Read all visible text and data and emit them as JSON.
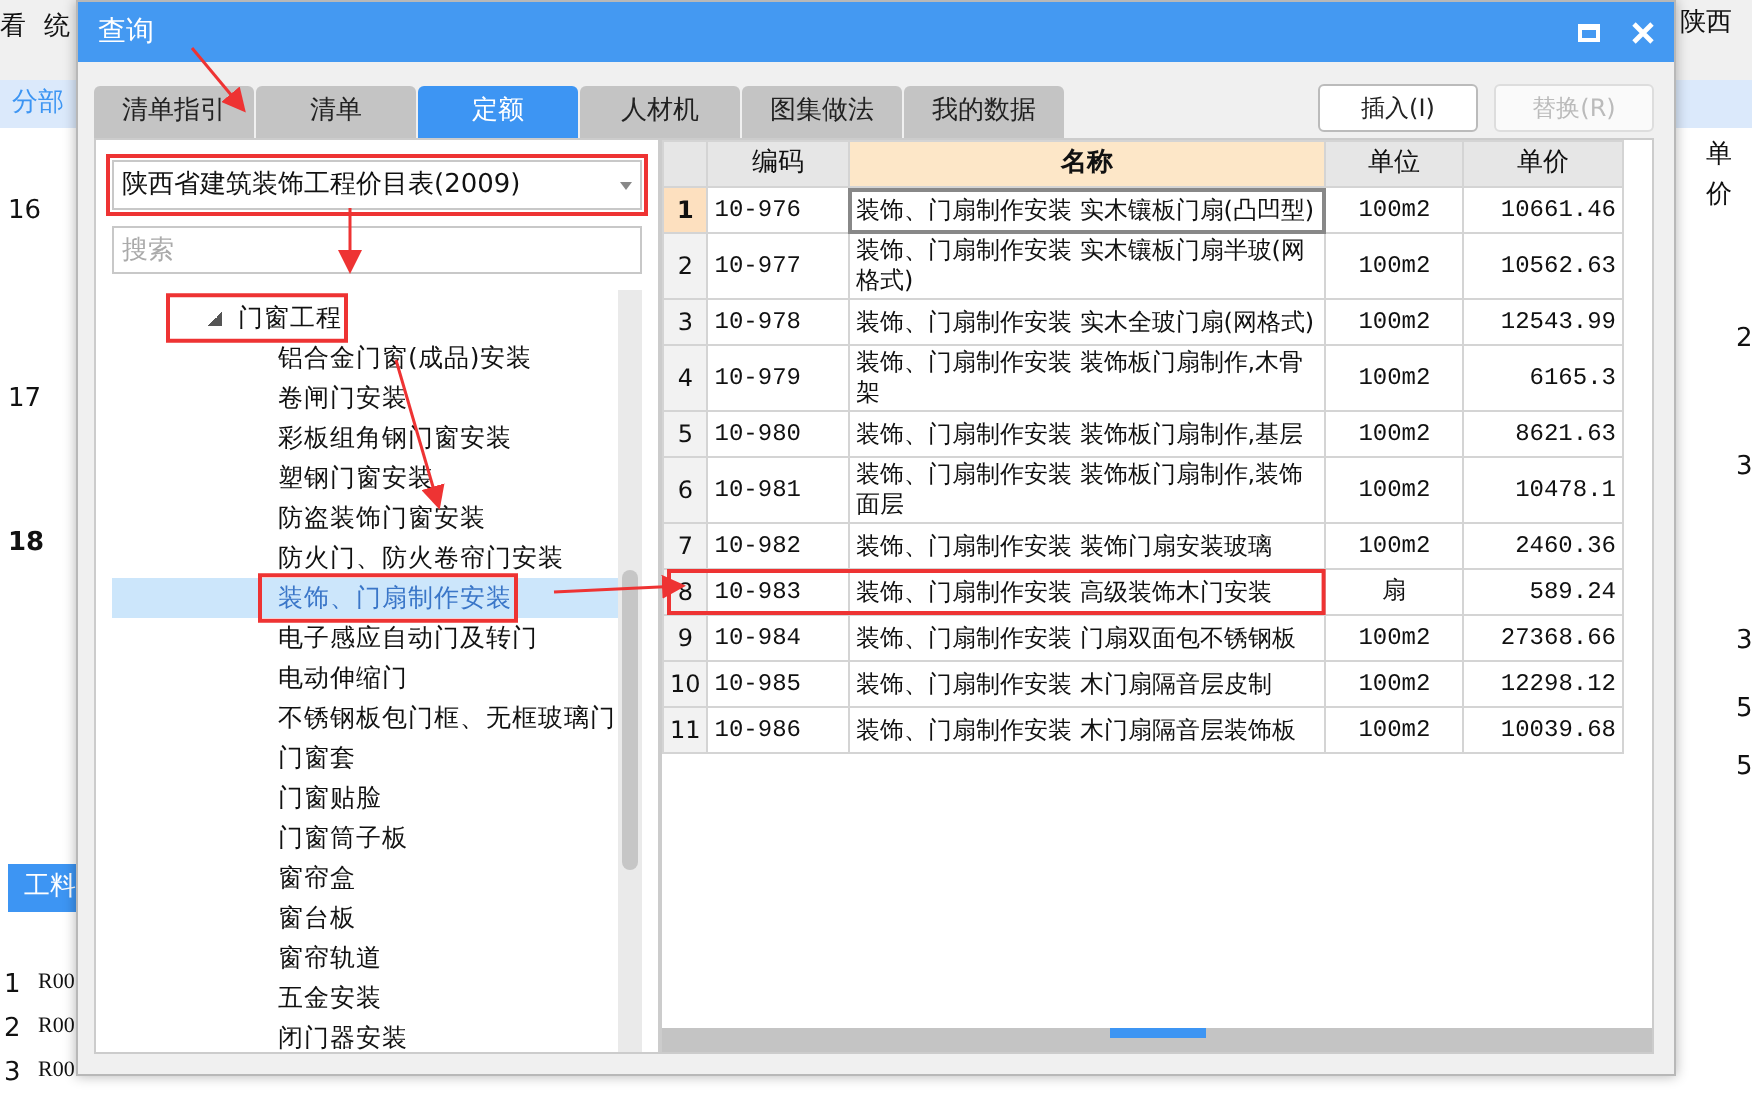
{
  "background_app": {
    "menu_texts": [
      "看",
      "统"
    ],
    "section_tab": "分部",
    "row_numbers": [
      "16",
      "17",
      "18"
    ],
    "bottom_tab": "工料",
    "bottom_rows": [
      {
        "number": "1",
        "code": "R00"
      },
      {
        "number": "2",
        "code": "R00"
      },
      {
        "number": "3",
        "code": "R00"
      }
    ],
    "region": "陕西",
    "price_header": "单价",
    "right_values": [
      "2",
      "3",
      "3",
      "5",
      "5"
    ]
  },
  "dialog": {
    "title": "查询",
    "tabs": [
      {
        "label": "清单指引",
        "selected": false
      },
      {
        "label": "清单",
        "selected": false
      },
      {
        "label": "定额",
        "selected": true
      },
      {
        "label": "人材机",
        "selected": false
      },
      {
        "label": "图集做法",
        "selected": false
      },
      {
        "label": "我的数据",
        "selected": false
      }
    ],
    "buttons": [
      {
        "label": "插入(I)",
        "disabled": false
      },
      {
        "label": "替换(R)",
        "disabled": true
      }
    ],
    "library": {
      "value": "陕西省建筑装饰工程价目表(2009)",
      "highlighted": true
    },
    "search": {
      "placeholder": "搜索"
    },
    "tree": [
      {
        "label": "门窗工程",
        "expanded": true,
        "selected": false,
        "highlighted": true,
        "children": [
          {
            "label": "铝合金门窗(成品)安装",
            "selected": false,
            "highlighted": false
          },
          {
            "label": "卷闸门安装",
            "selected": false,
            "highlighted": false
          },
          {
            "label": "彩板组角钢门窗安装",
            "selected": false,
            "highlighted": false
          },
          {
            "label": "塑钢门窗安装",
            "selected": false,
            "highlighted": false
          },
          {
            "label": "防盗装饰门窗安装",
            "selected": false,
            "highlighted": false
          },
          {
            "label": "防火门、防火卷帘门安装",
            "selected": false,
            "highlighted": false
          },
          {
            "label": "装饰、门扇制作安装",
            "selected": true,
            "highlighted": true
          },
          {
            "label": "电子感应自动门及转门",
            "selected": false,
            "highlighted": false
          },
          {
            "label": "电动伸缩门",
            "selected": false,
            "highlighted": false
          },
          {
            "label": "不锈钢板包门框、无框玻璃门",
            "selected": false,
            "highlighted": false
          },
          {
            "label": "门窗套",
            "selected": false,
            "highlighted": false
          },
          {
            "label": "门窗贴脸",
            "selected": false,
            "highlighted": false
          },
          {
            "label": "门窗筒子板",
            "selected": false,
            "highlighted": false
          },
          {
            "label": "窗帘盒",
            "selected": false,
            "highlighted": false
          },
          {
            "label": "窗台板",
            "selected": false,
            "highlighted": false
          },
          {
            "label": "窗帘轨道",
            "selected": false,
            "highlighted": false
          },
          {
            "label": "五金安装",
            "selected": false,
            "highlighted": false
          },
          {
            "label": "闭门器安装",
            "selected": false,
            "highlighted": false
          }
        ]
      }
    ],
    "table": {
      "columns": [
        {
          "label": "编码",
          "active": false
        },
        {
          "label": "名称",
          "active": true
        },
        {
          "label": "单位",
          "active": false
        },
        {
          "label": "单价",
          "active": false
        }
      ],
      "rows": [
        {
          "number": "1",
          "code": "10-976",
          "name": "装饰、门扇制作安装 实木镶板门扇(凸凹型)",
          "unit": "100m2",
          "price": "10661.46",
          "selected": true,
          "highlighted": false
        },
        {
          "number": "2",
          "code": "10-977",
          "name": "装饰、门扇制作安装 实木镶板门扇半玻(网格式)",
          "unit": "100m2",
          "price": "10562.63",
          "selected": false,
          "highlighted": false
        },
        {
          "number": "3",
          "code": "10-978",
          "name": "装饰、门扇制作安装 实木全玻门扇(网格式)",
          "unit": "100m2",
          "price": "12543.99",
          "selected": false,
          "highlighted": false
        },
        {
          "number": "4",
          "code": "10-979",
          "name": "装饰、门扇制作安装 装饰板门扇制作,木骨架",
          "unit": "100m2",
          "price": "6165.3",
          "selected": false,
          "highlighted": false
        },
        {
          "number": "5",
          "code": "10-980",
          "name": "装饰、门扇制作安装 装饰板门扇制作,基层",
          "unit": "100m2",
          "price": "8621.63",
          "selected": false,
          "highlighted": false
        },
        {
          "number": "6",
          "code": "10-981",
          "name": "装饰、门扇制作安装 装饰板门扇制作,装饰面层",
          "unit": "100m2",
          "price": "10478.1",
          "selected": false,
          "highlighted": false
        },
        {
          "number": "7",
          "code": "10-982",
          "name": "装饰、门扇制作安装 装饰门扇安装玻璃",
          "unit": "100m2",
          "price": "2460.36",
          "selected": false,
          "highlighted": false
        },
        {
          "number": "8",
          "code": "10-983",
          "name": "装饰、门扇制作安装 高级装饰木门安装",
          "unit": "扇",
          "price": "589.24",
          "selected": false,
          "highlighted": true
        },
        {
          "number": "9",
          "code": "10-984",
          "name": "装饰、门扇制作安装 门扇双面包不锈钢板",
          "unit": "100m2",
          "price": "27368.66",
          "selected": false,
          "highlighted": false
        },
        {
          "number": "10",
          "code": "10-985",
          "name": "装饰、门扇制作安装 木门扇隔音层皮制",
          "unit": "100m2",
          "price": "12298.12",
          "selected": false,
          "highlighted": false
        },
        {
          "number": "11",
          "code": "10-986",
          "name": "装饰、门扇制作安装 木门扇隔音层装饰板",
          "unit": "100m2",
          "price": "10039.68",
          "selected": false,
          "highlighted": false
        }
      ]
    }
  }
}
